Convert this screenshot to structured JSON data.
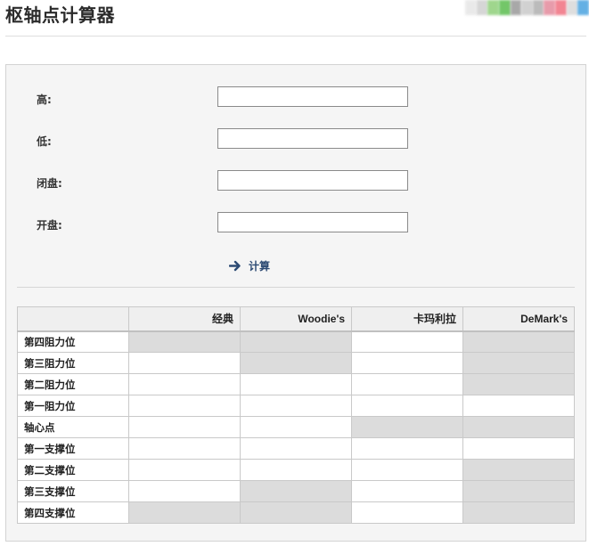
{
  "page": {
    "title": "枢轴点计算器"
  },
  "share_colors": [
    "#e6e6e6",
    "#cfcfcf",
    "#8fd07a",
    "#5bbd4f",
    "#9a9a9a",
    "#c9c9c9",
    "#b0b0b0",
    "#e38a9c",
    "#f07080",
    "#d9d9d9",
    "#4aa3e0"
  ],
  "form": {
    "fields": [
      {
        "label": "高:",
        "value": ""
      },
      {
        "label": "低:",
        "value": ""
      },
      {
        "label": "闭盘:",
        "value": ""
      },
      {
        "label": "开盘:",
        "value": ""
      }
    ],
    "submit_label": "计算",
    "submit_icon": "arrow-right-icon"
  },
  "table": {
    "headers": [
      "",
      "经典",
      "Woodie's",
      "卡玛利拉",
      "DeMark's"
    ],
    "rows": [
      {
        "label": "第四阻力位",
        "na": [
          true,
          true,
          false,
          true
        ]
      },
      {
        "label": "第三阻力位",
        "na": [
          false,
          true,
          false,
          true
        ]
      },
      {
        "label": "第二阻力位",
        "na": [
          false,
          false,
          false,
          true
        ]
      },
      {
        "label": "第一阻力位",
        "na": [
          false,
          false,
          false,
          false
        ]
      },
      {
        "label": "轴心点",
        "na": [
          false,
          false,
          true,
          true
        ]
      },
      {
        "label": "第一支撑位",
        "na": [
          false,
          false,
          false,
          false
        ]
      },
      {
        "label": "第二支撑位",
        "na": [
          false,
          false,
          false,
          true
        ]
      },
      {
        "label": "第三支撑位",
        "na": [
          false,
          true,
          false,
          true
        ]
      },
      {
        "label": "第四支撑位",
        "na": [
          true,
          true,
          false,
          true
        ]
      }
    ]
  }
}
